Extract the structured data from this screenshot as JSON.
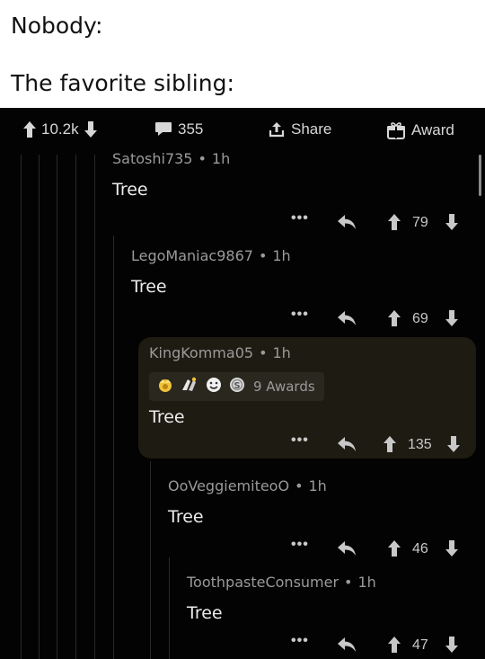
{
  "caption": {
    "line1": "Nobody:",
    "line2": "The favorite sibling:"
  },
  "post_bar": {
    "votes": "10.2k",
    "comments": "355",
    "share": "Share",
    "award": "Award"
  },
  "comments": [
    {
      "author": "Satoshi735",
      "age": "1h",
      "body": "Tree",
      "score": "79"
    },
    {
      "author": "LegoManiac9867",
      "age": "1h",
      "body": "Tree",
      "score": "69"
    },
    {
      "author": "KingKomma05",
      "age": "1h",
      "body": "Tree",
      "score": "135",
      "awards_label": "9 Awards",
      "highlighted": true
    },
    {
      "author": "OoVeggiemiteoO",
      "age": "1h",
      "body": "Tree",
      "score": "46"
    },
    {
      "author": "ToothpasteConsumer",
      "age": "1h",
      "body": "Tree",
      "score": "47"
    }
  ],
  "icons": {
    "more": "•••",
    "dot": "•"
  },
  "colors": {
    "background": "#030303",
    "highlight": "#1e1b12",
    "text": "#e6e6e6",
    "meta": "#9a9a9a"
  }
}
